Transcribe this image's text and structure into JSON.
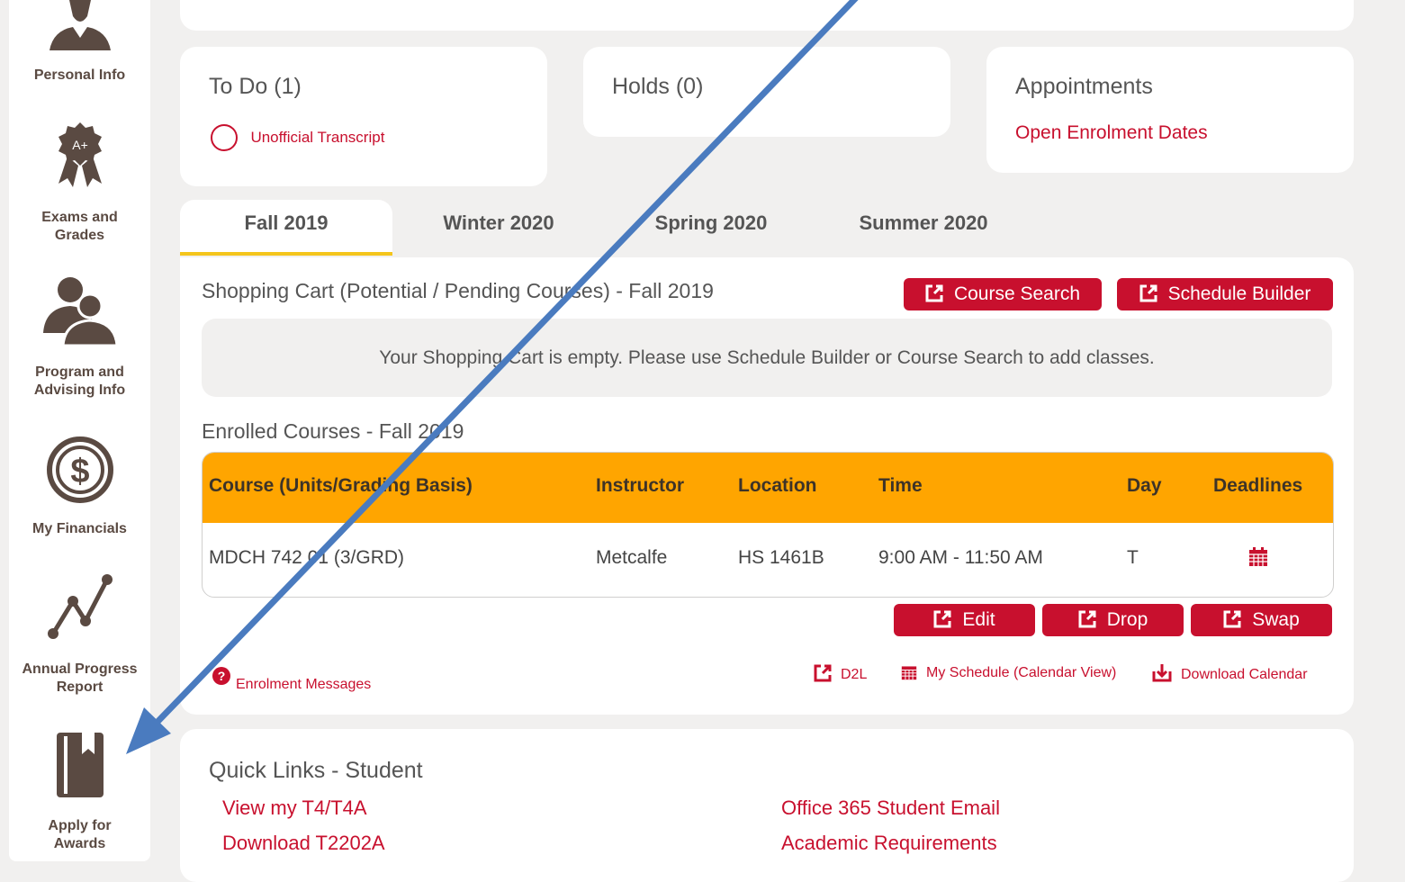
{
  "sidebar": {
    "items": [
      {
        "label": "Personal Info",
        "icon": "person-icon"
      },
      {
        "label": "Exams and\nGrades",
        "icon": "award-ribbon-icon"
      },
      {
        "label": "Program and\nAdvising Info",
        "icon": "people-icon"
      },
      {
        "label": "My Financials",
        "icon": "dollar-icon"
      },
      {
        "label": "Annual Progress\nReport",
        "icon": "line-graph-icon"
      },
      {
        "label": "Apply for\nAwards",
        "icon": "book-icon"
      }
    ]
  },
  "todo": {
    "title": "To Do (1)",
    "item": "Unofficial Transcript"
  },
  "holds": {
    "title": "Holds (0)"
  },
  "appointments": {
    "title": "Appointments",
    "link": "Open Enrolment Dates"
  },
  "tabs": [
    {
      "label": "Fall 2019",
      "active": true
    },
    {
      "label": "Winter 2020"
    },
    {
      "label": "Spring 2020"
    },
    {
      "label": "Summer 2020"
    }
  ],
  "cart": {
    "title": "Shopping Cart (Potential / Pending Courses) - Fall 2019",
    "course_search": "Course Search",
    "schedule_builder": "Schedule Builder",
    "empty_message": "Your Shopping Cart is empty. Please use Schedule Builder or Course Search to add classes."
  },
  "enrolled": {
    "title": "Enrolled Courses - Fall 2019",
    "headers": [
      "Course (Units/Grading Basis)",
      "Instructor",
      "Location",
      "Time",
      "Day",
      "Deadlines"
    ],
    "rows": [
      {
        "course": "MDCH 742 01 (3/GRD)",
        "instructor": "Metcalfe",
        "location": "HS 1461B",
        "time": "9:00 AM - 11:50 AM",
        "day": "T"
      }
    ],
    "edit": "Edit",
    "drop": "Drop",
    "swap": "Swap",
    "enrolment_messages": "Enrolment Messages",
    "d2l": "D2L",
    "my_schedule": "My Schedule (Calendar View)",
    "download_calendar": "Download Calendar"
  },
  "quick_links": {
    "title": "Quick Links - Student",
    "left": [
      "View my T4/T4A",
      "Download T2202A"
    ],
    "right": [
      "Office 365 Student Email",
      "Academic Requirements"
    ]
  },
  "colors": {
    "accent_red": "#c8102e",
    "table_header": "#ffa500",
    "tab_underline": "#f4c51c",
    "arrow": "#4a7bbf"
  }
}
